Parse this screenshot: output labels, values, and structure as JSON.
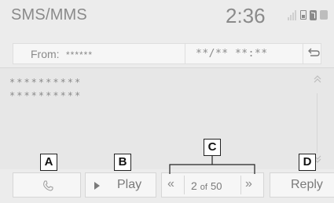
{
  "header": {
    "title": "SMS/MMS",
    "clock": "2:36",
    "status_icons": [
      "signal-icon",
      "battery-icon",
      "bluetooth-icon",
      "menu-icon"
    ]
  },
  "message": {
    "from_label": "From:",
    "from_value": "******",
    "date_time": "**/** **:**",
    "lines": [
      "**********",
      "**********"
    ]
  },
  "controls": {
    "call_icon": "phone-icon",
    "play_label": "Play",
    "pager": {
      "current": "2",
      "of_label": "of",
      "total": "50"
    },
    "reply_label": "Reply"
  },
  "callouts": {
    "a": "A",
    "b": "B",
    "c": "C",
    "d": "D"
  },
  "colors": {
    "background": "#ececec",
    "text": "#7a7a7a",
    "button": "#f6f6f6",
    "border": "#d6d6d6"
  }
}
